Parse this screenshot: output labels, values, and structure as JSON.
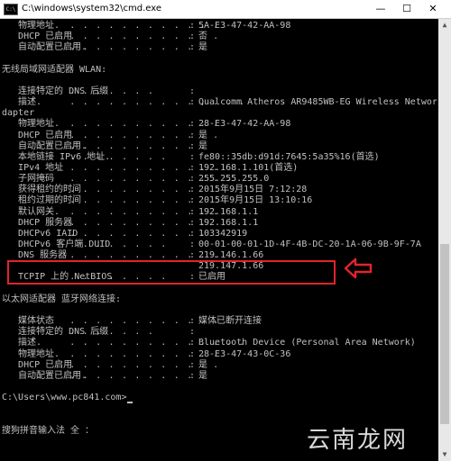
{
  "window": {
    "icon_label": "C:\\",
    "title": "C:\\windows\\system32\\cmd.exe",
    "minimize": "—",
    "maximize": "☐",
    "close": "✕"
  },
  "console": {
    "rows": [
      {
        "label": "   物理地址.",
        "dots": " . . . . . . . . . . . .",
        "colon": ":",
        "value": "5A-E3-47-42-AA-98"
      },
      {
        "label": "   DHCP 已启用",
        "dots": " . . . . . . . . . . . .",
        "colon": ":",
        "value": "否"
      },
      {
        "label": "   自动配置已启用.",
        "dots": " . . . . . . . . . . .",
        "colon": ":",
        "value": "是"
      },
      {
        "text": ""
      },
      {
        "text": "无线局域网适配器 WLAN:"
      },
      {
        "text": ""
      },
      {
        "label": "   连接特定的 DNS 后缀",
        "dots": " . . . . . . .",
        "colon": ":",
        "value": ""
      },
      {
        "label": "   描述.",
        "dots": " . . . . . . . . . . . . . .",
        "colon": ":",
        "value": "Qualcomm Atheros AR9485WB-EG Wireless Network A"
      },
      {
        "text": "dapter"
      },
      {
        "label": "   物理地址.",
        "dots": " . . . . . . . . . . . .",
        "colon": ":",
        "value": "28-E3-47-42-AA-98"
      },
      {
        "label": "   DHCP 已启用",
        "dots": " . . . . . . . . . . . .",
        "colon": ":",
        "value": "是"
      },
      {
        "label": "   自动配置已启用.",
        "dots": " . . . . . . . . . . .",
        "colon": ":",
        "value": "是"
      },
      {
        "label": "   本地链接 IPv6 地址.",
        "dots": " . . . . . . . .",
        "colon": ":",
        "value": "fe80::35db:d91d:7645:5a35%16(首选)"
      },
      {
        "label": "   IPv4 地址",
        "dots": " . . . . . . . . . . . .",
        "colon": ":",
        "value": "192.168.1.101(首选)"
      },
      {
        "label": "   子网掩码",
        "dots": " . . . . . . . . . . . . .",
        "colon": ":",
        "value": "255.255.255.0"
      },
      {
        "label": "   获得租约的时间",
        "dots": " . . . . . . . . . .",
        "colon": ":",
        "value": "2015年9月15日 7:12:28"
      },
      {
        "label": "   租约过期的时间",
        "dots": " . . . . . . . . . .",
        "colon": ":",
        "value": "2015年9月15日 13:10:16"
      },
      {
        "label": "   默认网关.",
        "dots": " . . . . . . . . . . . .",
        "colon": ":",
        "value": "192.168.1.1"
      },
      {
        "label": "   DHCP 服务器",
        "dots": " . . . . . . . . . . .",
        "colon": ":",
        "value": "192.168.1.1"
      },
      {
        "label": "   DHCPv6 IAID",
        "dots": " . . . . . . . . . . .",
        "colon": ":",
        "value": "103342919"
      },
      {
        "label": "   DHCPv6 客户端 DUID",
        "dots": " . . . . . . . .",
        "colon": ":",
        "value": "00-01-00-01-1D-4F-4B-DC-20-1A-06-9B-9F-7A"
      },
      {
        "label": "   DNS 服务器",
        "dots": " . . . . . . . . . . . .",
        "colon": ":",
        "value": "219.146.1.66"
      },
      {
        "label": "",
        "dots": "",
        "colon": "",
        "value": "219.147.1.66"
      },
      {
        "label": "   TCPIP 上的 NetBIOS",
        "dots": " . . . . . . . .",
        "colon": ":",
        "value": "已启用"
      },
      {
        "text": ""
      },
      {
        "text": "以太网适配器 蓝牙网络连接:"
      },
      {
        "text": ""
      },
      {
        "label": "   媒体状态",
        "dots": " . . . . . . . . . . . . .",
        "colon": ":",
        "value": "媒体已断开连接"
      },
      {
        "label": "   连接特定的 DNS 后缀",
        "dots": " . . . . . . .",
        "colon": ":",
        "value": ""
      },
      {
        "label": "   描述.",
        "dots": " . . . . . . . . . . . . . .",
        "colon": ":",
        "value": "Bluetooth Device (Personal Area Network)"
      },
      {
        "label": "   物理地址.",
        "dots": " . . . . . . . . . . . .",
        "colon": ":",
        "value": "28-E3-47-43-0C-36"
      },
      {
        "label": "   DHCP 已启用",
        "dots": " . . . . . . . . . . . .",
        "colon": ":",
        "value": "是"
      },
      {
        "label": "   自动配置已启用.",
        "dots": " . . . . . . . . . . .",
        "colon": ":",
        "value": "是"
      },
      {
        "text": ""
      },
      {
        "text": "C:\\Users\\www.pc841.com>"
      },
      {
        "text": ""
      },
      {
        "text": ""
      },
      {
        "text": "搜狗拼音输入法 全 ："
      }
    ]
  },
  "watermark": "云南龙网",
  "colors": {
    "console_bg": "#000000",
    "console_text": "#c0c0c0",
    "highlight": "#e2242a"
  }
}
